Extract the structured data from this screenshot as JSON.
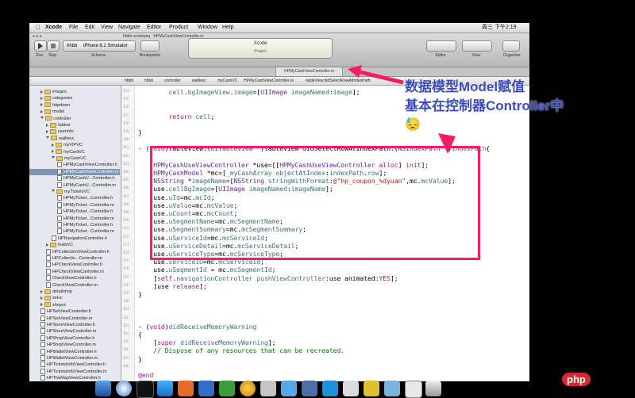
{
  "menubar": {
    "app": "Xcode",
    "items": [
      "File",
      "Edit",
      "View",
      "Navigate",
      "Editor",
      "Product",
      "Window",
      "Help"
    ],
    "clock": "周三 下午2:19"
  },
  "toolbar": {
    "run_label": "Run",
    "stop_label": "Stop",
    "scheme": "hhbb",
    "device": "iPhone 6.1 Simulator",
    "scheme_label": "Scheme",
    "breakpoints_label": "Breakpoints",
    "activity_title": "Xcode",
    "project_label": "Project",
    "editor_label": "Editor",
    "view_label": "View",
    "organizer_label": "Organizer"
  },
  "window_title": {
    "project": "hhbb.xcodeproj",
    "file": "HPMyCashViewController.m"
  },
  "tab": "HPMyCashViewController.m",
  "jumpbar": [
    "hhbb",
    "hhbb",
    "controller",
    "walltevc",
    "myCashVC",
    "HPMyCashViewController.m",
    "-tableView:didSelectRowAtIndexPath:"
  ],
  "navigator": [
    {
      "label": "images",
      "type": "folder",
      "indent": 0
    },
    {
      "label": "categories",
      "type": "folder",
      "indent": 0
    },
    {
      "label": "httpdown",
      "type": "folder",
      "indent": 0
    },
    {
      "label": "model",
      "type": "folder",
      "indent": 0
    },
    {
      "label": "controller",
      "type": "folder",
      "indent": 0,
      "open": true
    },
    {
      "label": "tabbar",
      "type": "folder",
      "indent": 1
    },
    {
      "label": "userinfo",
      "type": "folder",
      "indent": 1
    },
    {
      "label": "walltevc",
      "type": "folder",
      "indent": 1,
      "open": true
    },
    {
      "label": "myVIPVC",
      "type": "folder",
      "indent": 2
    },
    {
      "label": "myCardVC",
      "type": "folder",
      "indent": 2
    },
    {
      "label": "myCashVC",
      "type": "folder",
      "indent": 2,
      "open": true
    },
    {
      "label": "HPMyCashViewController.h",
      "type": "file",
      "indent": 3
    },
    {
      "label": "HPMyCashViewController.m",
      "type": "file",
      "indent": 3,
      "selected": true
    },
    {
      "label": "HPMyCashU...Controller.h",
      "type": "file",
      "indent": 3
    },
    {
      "label": "HPMyCashU...Controller.m",
      "type": "file",
      "indent": 3
    },
    {
      "label": "myTicketsVC",
      "type": "folder",
      "indent": 2,
      "open": true
    },
    {
      "label": "HPMyTicket...Controller.h",
      "type": "file",
      "indent": 3
    },
    {
      "label": "HPMyTicket...Controller.m",
      "type": "file",
      "indent": 3
    },
    {
      "label": "HPMyTicket...Controller.h",
      "type": "file",
      "indent": 3
    },
    {
      "label": "HPMyTicket...Controller.m",
      "type": "file",
      "indent": 3
    },
    {
      "label": "HPMyTicket...Controller.h",
      "type": "file",
      "indent": 3
    },
    {
      "label": "HPMyTicket...Controller.m",
      "type": "file",
      "indent": 3
    },
    {
      "label": "HPNavigationController.h",
      "type": "file",
      "indent": 2
    },
    {
      "label": "huibiVC",
      "type": "folder",
      "indent": 1
    },
    {
      "label": "HPCollectionViewController.h",
      "type": "file",
      "indent": 1
    },
    {
      "label": "HPCollectio...Controller.m",
      "type": "file",
      "indent": 1
    },
    {
      "label": "HPCheckViewController.h",
      "type": "file",
      "indent": 1
    },
    {
      "label": "HPCheckViewController.m",
      "type": "file",
      "indent": 1
    },
    {
      "label": "CheckViewController.h",
      "type": "file",
      "indent": 1
    },
    {
      "label": "CheckViewController.m",
      "type": "file",
      "indent": 1
    },
    {
      "label": "detailshop",
      "type": "folder",
      "indent": 0
    },
    {
      "label": "setvc",
      "type": "folder",
      "indent": 0
    },
    {
      "label": "shopvc",
      "type": "folder",
      "indent": 0
    },
    {
      "label": "HPSetViewController.h",
      "type": "file",
      "indent": 0
    },
    {
      "label": "HPSetViewController.m",
      "type": "file",
      "indent": 0
    },
    {
      "label": "HPStoreViewController.h",
      "type": "file",
      "indent": 0
    },
    {
      "label": "HPStoreViewController.m",
      "type": "file",
      "indent": 0
    },
    {
      "label": "HPShopViewController.h",
      "type": "file",
      "indent": 0
    },
    {
      "label": "HPShopViewController.m",
      "type": "file",
      "indent": 0
    },
    {
      "label": "HPWalletViewController.h",
      "type": "file",
      "indent": 0
    },
    {
      "label": "HPWalletViewController.m",
      "type": "file",
      "indent": 0
    },
    {
      "label": "HPTicketsInfoViewController.h",
      "type": "file",
      "indent": 0
    },
    {
      "label": "HPTicketsInfoViewController.m",
      "type": "file",
      "indent": 0
    },
    {
      "label": "HPTheMapViewController.h",
      "type": "file",
      "indent": 0
    }
  ],
  "line_numbers": [
    "254",
    "255",
    "256",
    "257",
    "258",
    "259",
    "260",
    "261",
    "262",
    "263",
    "264",
    "265",
    "266",
    "267",
    "268",
    "269",
    "270",
    "271",
    "272",
    "273",
    "274",
    "275",
    "276",
    "277",
    "278",
    "279",
    "280",
    "281",
    "282",
    "283",
    "284",
    "285",
    "286",
    "287",
    "288"
  ],
  "code": [
    "        cell.bgImageView.image=[UIImage imageNamed:image];",
    "",
    "",
    "        return cell;",
    "",
    "}",
    "",
    "- (void)tableView:(UITableView *)tableView didSelectRowAtIndexPath:(NSIndexPath *)indexPath{",
    "",
    "    HPMyCashUseViewController *use=[[HPMyCashUseViewController alloc] init];",
    "    HPMyCashModel *mc=[_myCashArray objectAtIndex:indexPath.row];",
    "    NSString *imageName=[NSString stringWithFormat:@\"hp_coupon_%dyuan\",mc.mcValue];",
    "    use.cellBgImage=[UIImage imageNamed:imageName];",
    "    use.uId=mc.mcId;",
    "    use.uValue=mc.mcValue;",
    "    use.uCount=mc.mcCount;",
    "    use.uSegmentName=mc.mcSegmentName;",
    "    use.uSegmentSummary=mc.mcSegmentSummary;",
    "    use.uServiceId=mc.mcServiceId;",
    "    use.uServiceDetail=mc.mcServiceDetail;",
    "    use.uServiceType=mc.mcServiceType;",
    "    use.serviceID=mc.mcServiceId;",
    "    use.uSegmentId = mc.mcSegmentId;",
    "    [self.navigationController pushViewController:use animated:YES];",
    "    [use release];",
    "}",
    "",
    "",
    "",
    "- (void)didReceiveMemoryWarning",
    "{",
    "    [super didReceiveMemoryWarning];",
    "    // Dispose of any resources that can be recreated.",
    "}",
    "",
    "@end"
  ],
  "annotation": {
    "line1": "数据模型Model赋值",
    "line2": "基本在控制器Controller中",
    "emoji": "😓",
    "color": "#3b4cc0",
    "box_color": "#ff1a64"
  },
  "watermark": "php"
}
